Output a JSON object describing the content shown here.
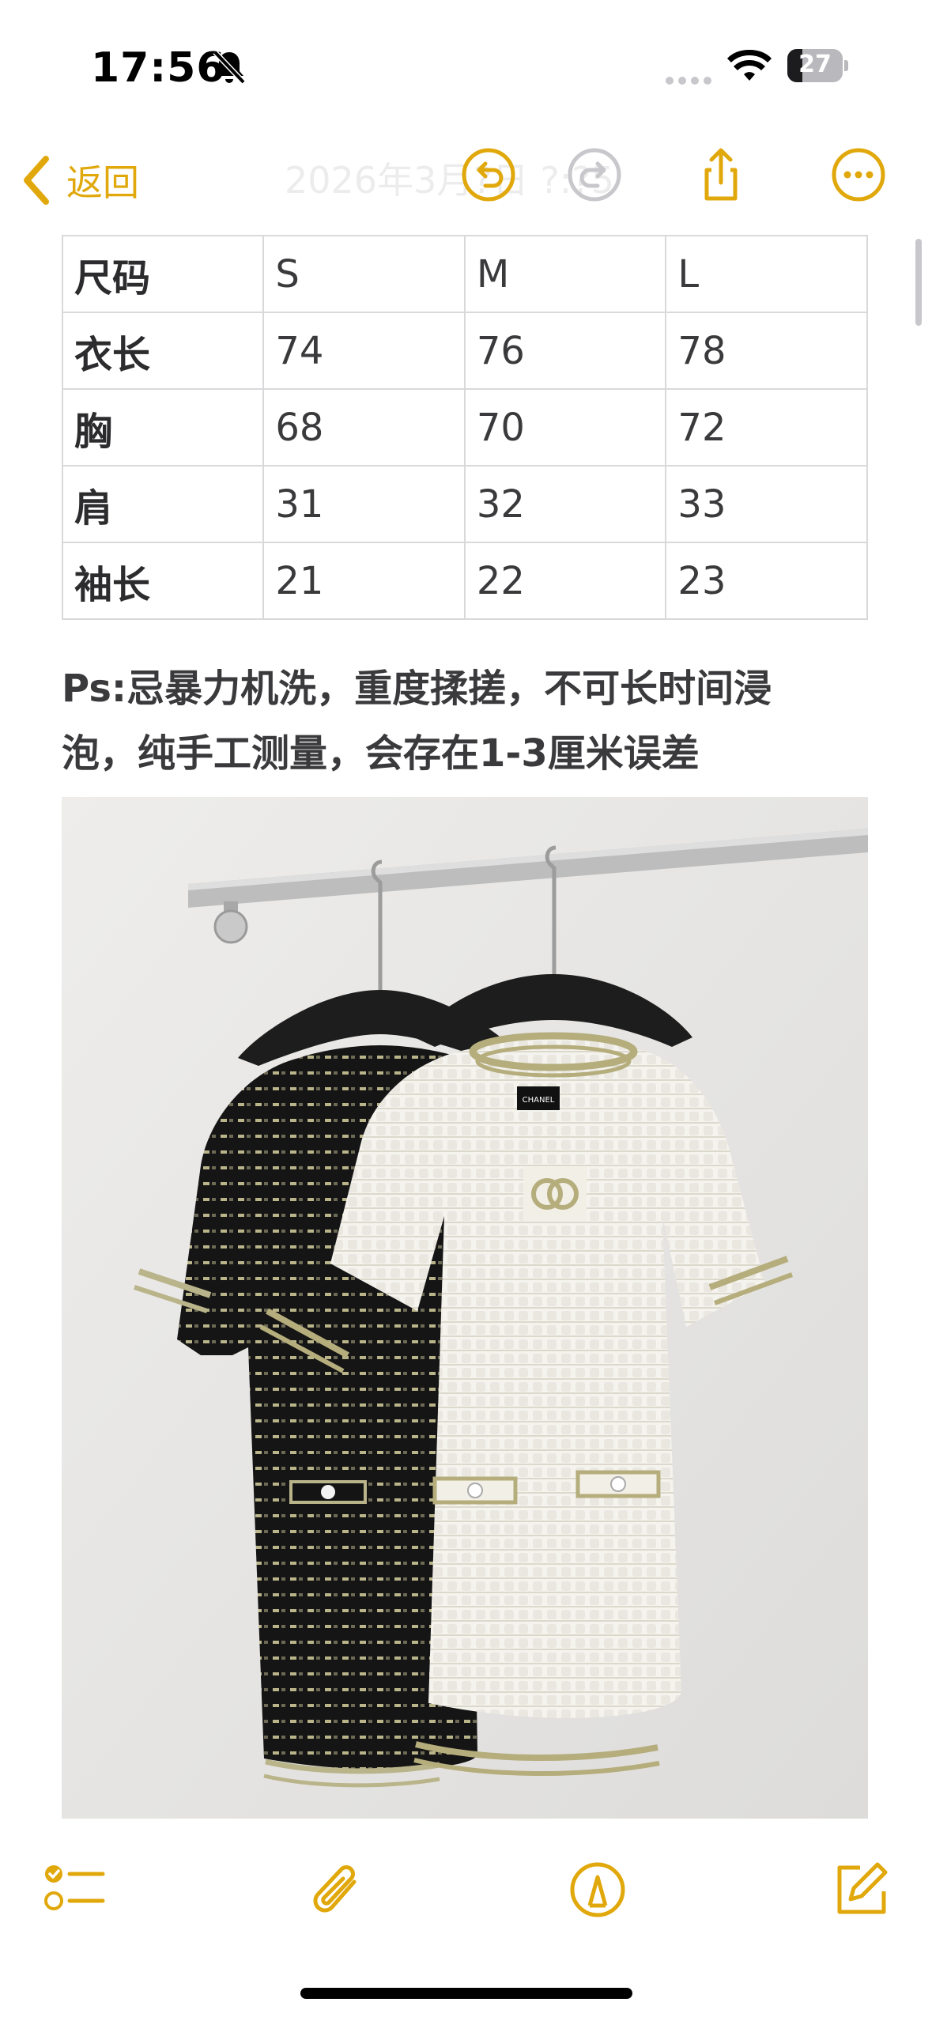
{
  "status_bar": {
    "time": "17:56",
    "battery": "27",
    "battery_level": 0.27,
    "icons": [
      "bell-slash-icon",
      "signal-icon",
      "wifi-icon",
      "battery-icon"
    ]
  },
  "nav": {
    "back_label": "返回",
    "title": "2026年3月?日 ?:?5",
    "icons": [
      "chevron-left-icon",
      "undo-icon",
      "redo-icon",
      "share-icon",
      "more-icon"
    ],
    "accent_color": "#e1a80c"
  },
  "size_table": {
    "rows": [
      [
        "尺码",
        "S",
        "M",
        "L"
      ],
      [
        "衣长",
        "74",
        "76",
        "78"
      ],
      [
        "胸",
        "68",
        "70",
        "72"
      ],
      [
        "肩",
        "31",
        "32",
        "33"
      ],
      [
        "袖长",
        "21",
        "22",
        "23"
      ]
    ]
  },
  "note": {
    "line1": "Ps:忌暴力机洗，重度揉搓，不可长时间浸",
    "line2": "泡，纯手工测量，会存在1-3厘米误差"
  },
  "photo": {
    "label_text": "CHANEL"
  },
  "toolbar": {
    "icons": [
      "checklist-icon",
      "paperclip-icon",
      "markup-icon",
      "compose-icon"
    ]
  }
}
